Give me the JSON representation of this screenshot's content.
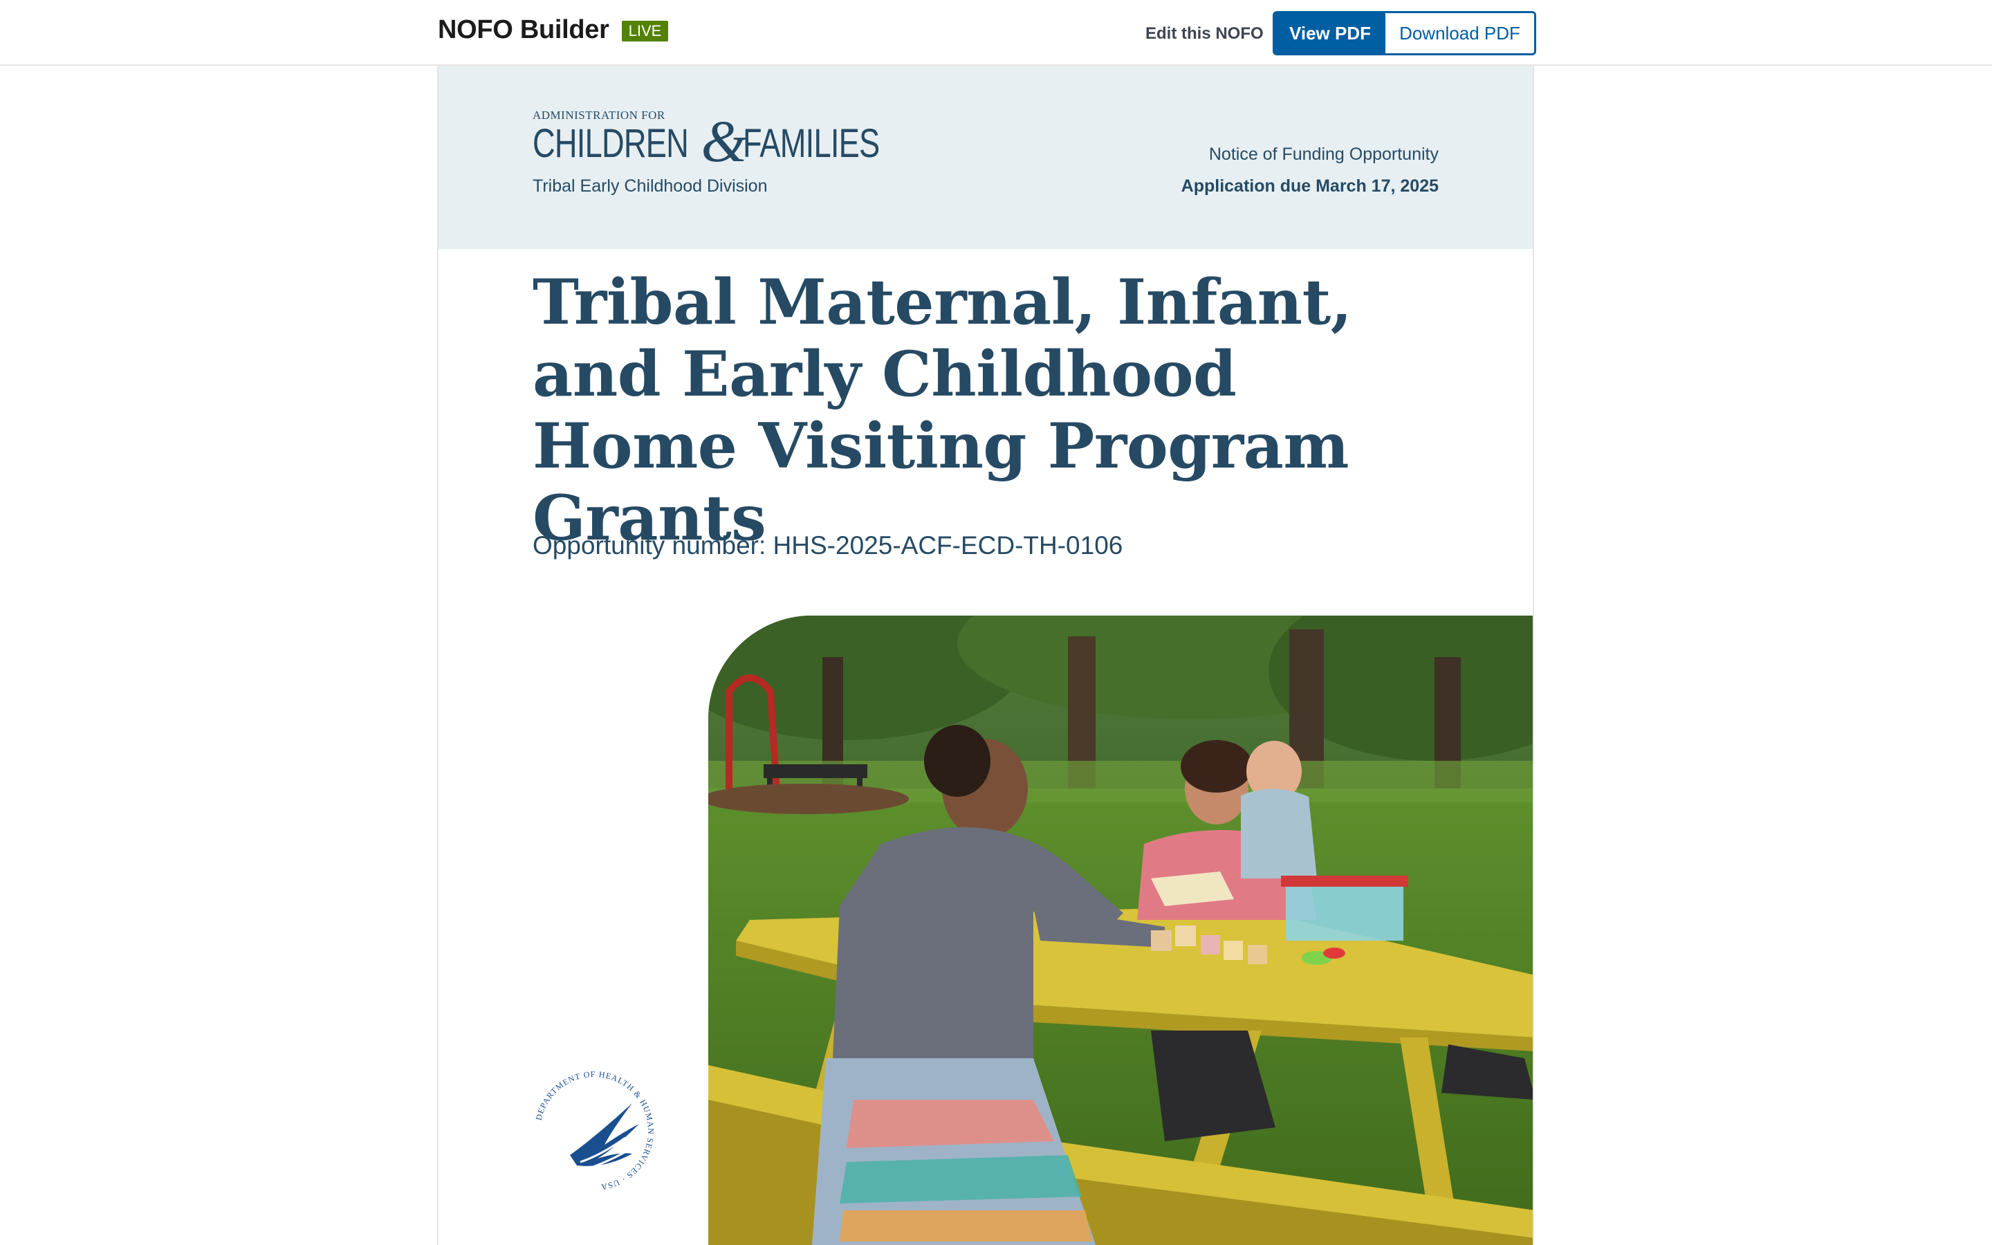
{
  "header": {
    "app_title": "NOFO Builder",
    "status_badge": "LIVE",
    "edit_link": "Edit this NOFO",
    "view_pdf_button": "View PDF",
    "download_pdf_button": "Download PDF"
  },
  "document": {
    "logo": {
      "line1": "ADMINISTRATION FOR",
      "word1": "CHILDREN",
      "ampersand": "&",
      "word2": "FAMILIES"
    },
    "division": "Tribal Early Childhood Division",
    "notice_type": "Notice of Funding Opportunity",
    "application_due": "Application due March 17, 2025",
    "title": "Tribal Maternal, Infant, and Early Childhood Home Visiting Program Grants",
    "opportunity_number": "Opportunity number: HHS-2025-ACF-ECD-TH-0106",
    "seal_text": "DEPARTMENT OF HEALTH & HUMAN SERVICES · USA"
  },
  "colors": {
    "brand_navy": "#264a64",
    "primary_blue": "#005ea2",
    "live_green": "#538200",
    "banner_bg": "#e7eff2"
  }
}
